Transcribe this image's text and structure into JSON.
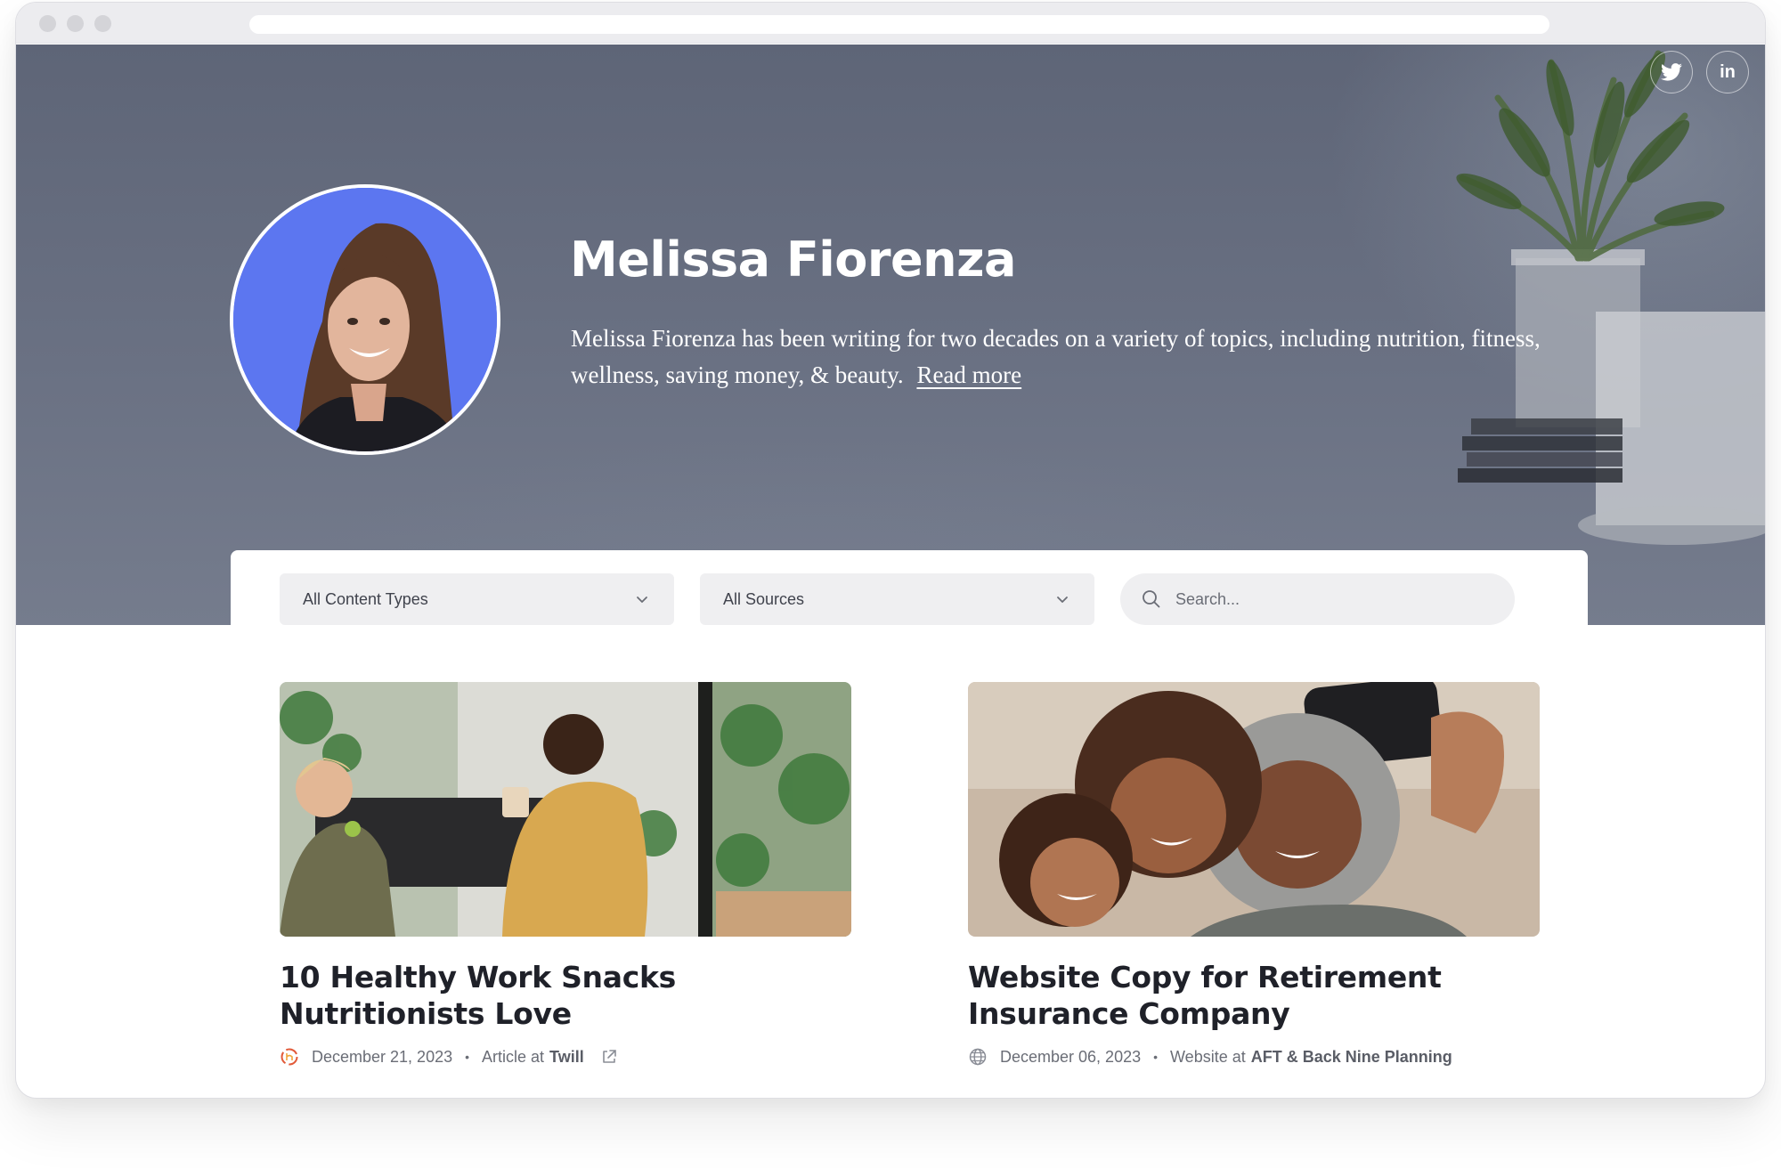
{
  "social": [
    {
      "name": "twitter-icon"
    },
    {
      "name": "linkedin-icon",
      "glyph": "in"
    }
  ],
  "author": {
    "name": "Melissa Fiorenza",
    "bio": "Melissa Fiorenza has been writing for two decades on a variety of topics, including nutrition, fitness, wellness, saving money, & beauty.",
    "read_more": "Read more"
  },
  "filters": {
    "content_type": "All Content Types",
    "source": "All Sources",
    "search_placeholder": "Search..."
  },
  "cards": [
    {
      "title": "10 Healthy Work Snacks Nutritionists Love",
      "date": "December 21, 2023",
      "separator": "•",
      "type_prefix": "Article at",
      "publisher": "Twill",
      "source_icon": "twill-logo-icon",
      "has_external_link": true
    },
    {
      "title": "Website Copy for Retirement Insurance Company",
      "date": "December 06, 2023",
      "separator": "•",
      "type_prefix": "Website at",
      "publisher": "AFT & Back Nine Planning",
      "source_icon": "globe-icon",
      "has_external_link": false
    }
  ],
  "colors": {
    "hero_bg": "#666d7f",
    "avatar_bg": "#5c76f0",
    "title_text": "#1f2129",
    "meta_text": "#6a6d76",
    "control_bg": "#efeff1"
  }
}
